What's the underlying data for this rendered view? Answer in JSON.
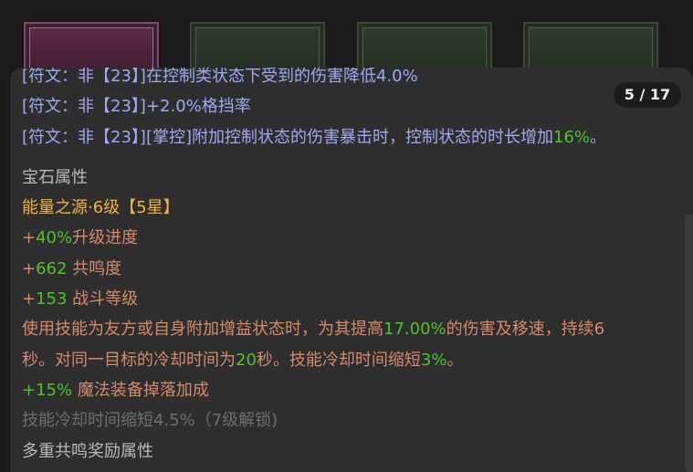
{
  "counter": {
    "text": "5 / 17"
  },
  "runes": [
    {
      "prefix": "[符文：非【23】]",
      "text": "在控制类状态下受到的伤害降低",
      "value": "4.0%",
      "suffix": ""
    },
    {
      "prefix": "[符文：非【23】]",
      "text": "+2.0%格挡率",
      "value": "",
      "suffix": ""
    },
    {
      "prefix": "[符文：非【23】]",
      "text": "[掌控]附加控制状态的伤害暴击时，控制状态的时长增加",
      "value": "16%",
      "suffix": "。"
    }
  ],
  "gem": {
    "section_title": "宝石属性",
    "name": "能量之源·6级【5星】",
    "stats": [
      {
        "sign": "+",
        "value": "40%",
        "label": "升级进度"
      },
      {
        "sign": "+",
        "value": "662",
        "label": " 共鸣度"
      },
      {
        "sign": "+",
        "value": "153",
        "label": " 战斗等级"
      }
    ],
    "effect_line1": {
      "pre": "使用技能为友方或自身附加增益状态时，为其提高",
      "value": "17.00%",
      "post": "的伤害及移速，持续6"
    },
    "effect_line2": {
      "pre": "秒。对同一目标的冷却时间为",
      "value": "20",
      "mid": "秒。技能冷却时间缩短",
      "value2": "3%",
      "post": "。"
    },
    "bonus": {
      "sign": "+",
      "value": "15%",
      "label": " 魔法装备掉落加成"
    },
    "locked": "技能冷却时间缩短4.5%（7级解锁)"
  },
  "resonance": {
    "title": "多重共鸣奖励属性"
  },
  "colors": {
    "rune": "#9fa8f2",
    "positive": "#4fc22a",
    "gem_name": "#f0b33d",
    "effect": "#d68a6c",
    "muted": "#6e6e6e",
    "panel": "#2e2e2e"
  },
  "slots": [
    {
      "state": "selected"
    },
    {
      "state": "normal"
    },
    {
      "state": "normal"
    },
    {
      "state": "normal"
    }
  ]
}
